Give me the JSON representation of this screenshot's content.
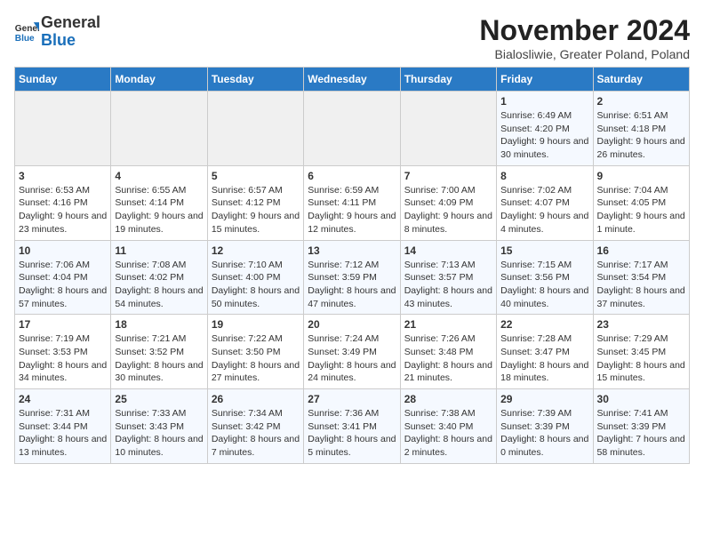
{
  "header": {
    "logo_line1": "General",
    "logo_line2": "Blue",
    "month_title": "November 2024",
    "location": "Bialosliwie, Greater Poland, Poland"
  },
  "days_of_week": [
    "Sunday",
    "Monday",
    "Tuesday",
    "Wednesday",
    "Thursday",
    "Friday",
    "Saturday"
  ],
  "weeks": [
    [
      {
        "day": "",
        "info": ""
      },
      {
        "day": "",
        "info": ""
      },
      {
        "day": "",
        "info": ""
      },
      {
        "day": "",
        "info": ""
      },
      {
        "day": "",
        "info": ""
      },
      {
        "day": "1",
        "info": "Sunrise: 6:49 AM\nSunset: 4:20 PM\nDaylight: 9 hours and 30 minutes."
      },
      {
        "day": "2",
        "info": "Sunrise: 6:51 AM\nSunset: 4:18 PM\nDaylight: 9 hours and 26 minutes."
      }
    ],
    [
      {
        "day": "3",
        "info": "Sunrise: 6:53 AM\nSunset: 4:16 PM\nDaylight: 9 hours and 23 minutes."
      },
      {
        "day": "4",
        "info": "Sunrise: 6:55 AM\nSunset: 4:14 PM\nDaylight: 9 hours and 19 minutes."
      },
      {
        "day": "5",
        "info": "Sunrise: 6:57 AM\nSunset: 4:12 PM\nDaylight: 9 hours and 15 minutes."
      },
      {
        "day": "6",
        "info": "Sunrise: 6:59 AM\nSunset: 4:11 PM\nDaylight: 9 hours and 12 minutes."
      },
      {
        "day": "7",
        "info": "Sunrise: 7:00 AM\nSunset: 4:09 PM\nDaylight: 9 hours and 8 minutes."
      },
      {
        "day": "8",
        "info": "Sunrise: 7:02 AM\nSunset: 4:07 PM\nDaylight: 9 hours and 4 minutes."
      },
      {
        "day": "9",
        "info": "Sunrise: 7:04 AM\nSunset: 4:05 PM\nDaylight: 9 hours and 1 minute."
      }
    ],
    [
      {
        "day": "10",
        "info": "Sunrise: 7:06 AM\nSunset: 4:04 PM\nDaylight: 8 hours and 57 minutes."
      },
      {
        "day": "11",
        "info": "Sunrise: 7:08 AM\nSunset: 4:02 PM\nDaylight: 8 hours and 54 minutes."
      },
      {
        "day": "12",
        "info": "Sunrise: 7:10 AM\nSunset: 4:00 PM\nDaylight: 8 hours and 50 minutes."
      },
      {
        "day": "13",
        "info": "Sunrise: 7:12 AM\nSunset: 3:59 PM\nDaylight: 8 hours and 47 minutes."
      },
      {
        "day": "14",
        "info": "Sunrise: 7:13 AM\nSunset: 3:57 PM\nDaylight: 8 hours and 43 minutes."
      },
      {
        "day": "15",
        "info": "Sunrise: 7:15 AM\nSunset: 3:56 PM\nDaylight: 8 hours and 40 minutes."
      },
      {
        "day": "16",
        "info": "Sunrise: 7:17 AM\nSunset: 3:54 PM\nDaylight: 8 hours and 37 minutes."
      }
    ],
    [
      {
        "day": "17",
        "info": "Sunrise: 7:19 AM\nSunset: 3:53 PM\nDaylight: 8 hours and 34 minutes."
      },
      {
        "day": "18",
        "info": "Sunrise: 7:21 AM\nSunset: 3:52 PM\nDaylight: 8 hours and 30 minutes."
      },
      {
        "day": "19",
        "info": "Sunrise: 7:22 AM\nSunset: 3:50 PM\nDaylight: 8 hours and 27 minutes."
      },
      {
        "day": "20",
        "info": "Sunrise: 7:24 AM\nSunset: 3:49 PM\nDaylight: 8 hours and 24 minutes."
      },
      {
        "day": "21",
        "info": "Sunrise: 7:26 AM\nSunset: 3:48 PM\nDaylight: 8 hours and 21 minutes."
      },
      {
        "day": "22",
        "info": "Sunrise: 7:28 AM\nSunset: 3:47 PM\nDaylight: 8 hours and 18 minutes."
      },
      {
        "day": "23",
        "info": "Sunrise: 7:29 AM\nSunset: 3:45 PM\nDaylight: 8 hours and 15 minutes."
      }
    ],
    [
      {
        "day": "24",
        "info": "Sunrise: 7:31 AM\nSunset: 3:44 PM\nDaylight: 8 hours and 13 minutes."
      },
      {
        "day": "25",
        "info": "Sunrise: 7:33 AM\nSunset: 3:43 PM\nDaylight: 8 hours and 10 minutes."
      },
      {
        "day": "26",
        "info": "Sunrise: 7:34 AM\nSunset: 3:42 PM\nDaylight: 8 hours and 7 minutes."
      },
      {
        "day": "27",
        "info": "Sunrise: 7:36 AM\nSunset: 3:41 PM\nDaylight: 8 hours and 5 minutes."
      },
      {
        "day": "28",
        "info": "Sunrise: 7:38 AM\nSunset: 3:40 PM\nDaylight: 8 hours and 2 minutes."
      },
      {
        "day": "29",
        "info": "Sunrise: 7:39 AM\nSunset: 3:39 PM\nDaylight: 8 hours and 0 minutes."
      },
      {
        "day": "30",
        "info": "Sunrise: 7:41 AM\nSunset: 3:39 PM\nDaylight: 7 hours and 58 minutes."
      }
    ]
  ]
}
